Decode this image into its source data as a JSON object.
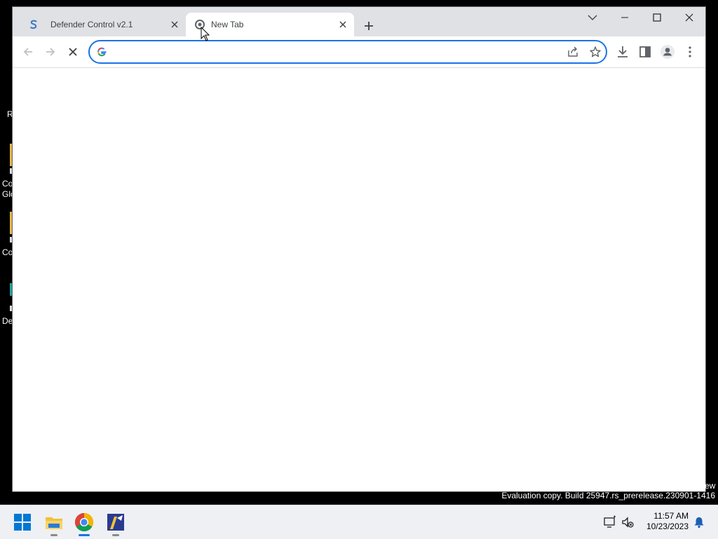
{
  "desktop": {
    "labels": [
      "R",
      "Co",
      "Glo",
      "Co",
      "De"
    ]
  },
  "tabs": [
    {
      "title": "Defender Control v2.1",
      "active": false
    },
    {
      "title": "New Tab",
      "active": true
    }
  ],
  "omnibox": {
    "value": "",
    "placeholder": ""
  },
  "watermark": {
    "text": "Evaluation copy. Build 25947.rs_prerelease.230901-1416",
    "cut": "ew"
  },
  "taskbar": {
    "time": "11:57 AM",
    "date": "10/23/2023"
  },
  "colors": {
    "accent": "#1a73e8",
    "tabstrip": "#dfe1e5",
    "taskbar": "#eef0f4"
  }
}
